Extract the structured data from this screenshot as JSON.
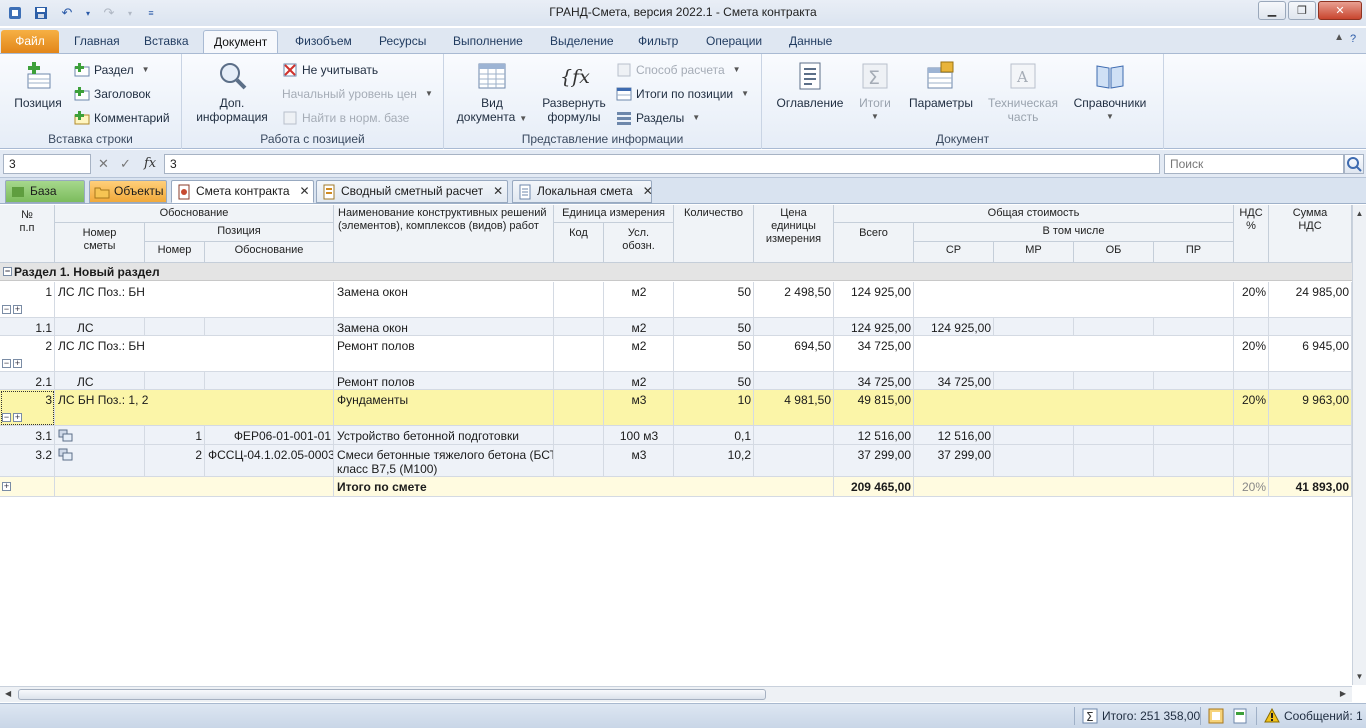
{
  "window": {
    "title": "ГРАНД-Смета, версия 2022.1 - Смета контракта"
  },
  "ribbon_tabs": [
    "Файл",
    "Главная",
    "Вставка",
    "Документ",
    "Физобъем",
    "Ресурсы",
    "Выполнение",
    "Выделение",
    "Фильтр",
    "Операции",
    "Данные"
  ],
  "ribbon": {
    "insert_row": {
      "label": "Вставка строки",
      "position_btn": "Позиция",
      "section_btn": "Раздел",
      "header_btn": "Заголовок",
      "comment_btn": "Комментарий"
    },
    "work_position": {
      "label": "Работа с позицией",
      "info_btn_line1": "Доп.",
      "info_btn_line2": "информация",
      "ignore_btn": "Не учитывать",
      "price_level_btn": "Начальный уровень цен",
      "find_btn": "Найти в норм. базе"
    },
    "view_info": {
      "label": "Представление информации",
      "view_btn_line1": "Вид",
      "view_btn_line2": "документа",
      "formulas_btn_line1": "Развернуть",
      "formulas_btn_line2": "формулы",
      "calc_method_btn": "Способ расчета",
      "totals_pos_btn": "Итоги по позиции",
      "sections_btn": "Разделы"
    },
    "document": {
      "label": "Документ",
      "toc_btn": "Оглавление",
      "totals_btn": "Итоги",
      "params_btn": "Параметры",
      "tech_btn_line1": "Техническая",
      "tech_btn_line2": "часть",
      "refs_btn": "Справочники"
    }
  },
  "formula_bar": {
    "cell_ref": "3",
    "value": "3",
    "search_placeholder": "Поиск",
    "fx": "fx"
  },
  "doc_tabs": [
    {
      "label": "База"
    },
    {
      "label": "Объекты"
    },
    {
      "label": "Смета контракта"
    },
    {
      "label": "Сводный сметный расчет"
    },
    {
      "label": "Локальная смета"
    }
  ],
  "grid_headers": {
    "num_line1": "№",
    "num_line2": "п.п",
    "justification": "Обоснование",
    "estimate_num_line1": "Номер",
    "estimate_num_line2": "сметы",
    "position": "Позиция",
    "pos_number": "Номер",
    "pos_justification": "Обоснование",
    "name_line1": "Наименование конструктивных решений",
    "name_line2": "(элементов), комплексов (видов) работ",
    "unit": "Единица измерения",
    "unit_code": "Код",
    "unit_symbol_line1": "Усл.",
    "unit_symbol_line2": "обозн.",
    "quantity": "Количество",
    "price_line1": "Цена",
    "price_line2": "единицы",
    "price_line3": "измерения",
    "total_cost": "Общая стоимость",
    "total": "Всего",
    "including": "В том числе",
    "sr": "СР",
    "mr": "МР",
    "ob": "ОБ",
    "pr": "ПР",
    "vat_pct_line1": "НДС",
    "vat_pct_line2": "%",
    "vat_sum_line1": "Сумма",
    "vat_sum_line2": "НДС"
  },
  "section_title": "Раздел 1. Новый раздел",
  "rows": [
    {
      "num": "1",
      "est": "ЛС ЛС Поз.: БН",
      "pnum": "",
      "pjust": "",
      "name": "Замена окон",
      "name2": "",
      "code": "",
      "unit": "м2",
      "qty": "50",
      "price": "2 498,50",
      "total": "124 925,00",
      "sr": "",
      "vat": "20%",
      "vatsum": "24 985,00"
    },
    {
      "num": "1.1",
      "est": "ЛС",
      "pnum": "",
      "pjust": "",
      "name": "Замена окон",
      "name2": "",
      "code": "",
      "unit": "м2",
      "qty": "50",
      "price": "",
      "total": "124 925,00",
      "sr": "124 925,00",
      "vat": "",
      "vatsum": ""
    },
    {
      "num": "2",
      "est": "ЛС ЛС Поз.: БН",
      "pnum": "",
      "pjust": "",
      "name": "Ремонт полов",
      "name2": "",
      "code": "",
      "unit": "м2",
      "qty": "50",
      "price": "694,50",
      "total": "34 725,00",
      "sr": "",
      "vat": "20%",
      "vatsum": "6 945,00"
    },
    {
      "num": "2.1",
      "est": "ЛС",
      "pnum": "",
      "pjust": "",
      "name": "Ремонт полов",
      "name2": "",
      "code": "",
      "unit": "м2",
      "qty": "50",
      "price": "",
      "total": "34 725,00",
      "sr": "34 725,00",
      "vat": "",
      "vatsum": ""
    },
    {
      "num": "3",
      "est": "ЛС БН Поз.: 1, 2",
      "pnum": "",
      "pjust": "",
      "name": "Фундаменты",
      "name2": "",
      "code": "",
      "unit": "м3",
      "qty": "10",
      "price": "4 981,50",
      "total": "49 815,00",
      "sr": "",
      "vat": "20%",
      "vatsum": "9 963,00"
    },
    {
      "num": "3.1",
      "est": "",
      "pnum": "1",
      "pjust": "ФЕР06-01-001-01",
      "name": "Устройство бетонной подготовки",
      "name2": "",
      "code": "",
      "unit": "100 м3",
      "qty": "0,1",
      "price": "",
      "total": "12 516,00",
      "sr": "12 516,00",
      "vat": "",
      "vatsum": ""
    },
    {
      "num": "3.2",
      "est": "",
      "pnum": "2",
      "pjust": "ФССЦ-04.1.02.05-0003",
      "name": "Смеси бетонные тяжелого бетона (БСТ),",
      "name2": "класс В7,5 (М100)",
      "code": "",
      "unit": "м3",
      "qty": "10,2",
      "price": "",
      "total": "37 299,00",
      "sr": "37 299,00",
      "vat": "",
      "vatsum": ""
    }
  ],
  "totals_row": {
    "label": "Итого по смете",
    "total": "209 465,00",
    "vat": "20%",
    "vatsum": "41 893,00"
  },
  "status_bar": {
    "total_text": "Итого: 251 358,00",
    "messages_text": "Сообщений: 1"
  }
}
